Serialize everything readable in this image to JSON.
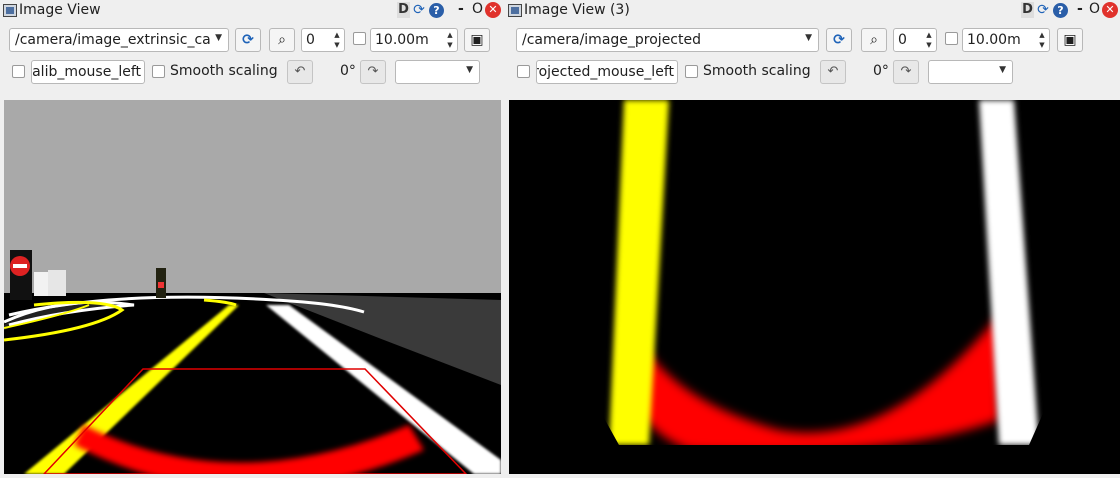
{
  "left_panel": {
    "title": "Image View",
    "topic": "/camera/image_extrinsic_ca",
    "spin_value": "0",
    "distance_value": "10.00m",
    "mouse_topic": "alib_mouse_left",
    "smooth_label": "Smooth scaling",
    "rotation": "0°"
  },
  "right_panel": {
    "title": "Image View (3)",
    "topic": "/camera/image_projected",
    "spin_value": "0",
    "distance_value": "10.00m",
    "mouse_topic": "rojected_mouse_left",
    "smooth_label": "Smooth scaling",
    "rotation": "0°"
  },
  "window_controls": {
    "dock_label": "D",
    "help_label": "?",
    "minimize_label": "-",
    "float_label": "O",
    "close_label": "✕"
  },
  "icons": [
    "window-icon",
    "reload-icon",
    "help-icon",
    "close-icon",
    "refresh-icon",
    "zoom-icon",
    "save-icon",
    "rotate-left-icon",
    "rotate-right-icon"
  ],
  "colors": {
    "lane_yellow": "#ffff00",
    "lane_white": "#ffffff",
    "lane_red": "#ff0000",
    "sky_gray": "#a9a9a9",
    "road_black": "#000000"
  }
}
